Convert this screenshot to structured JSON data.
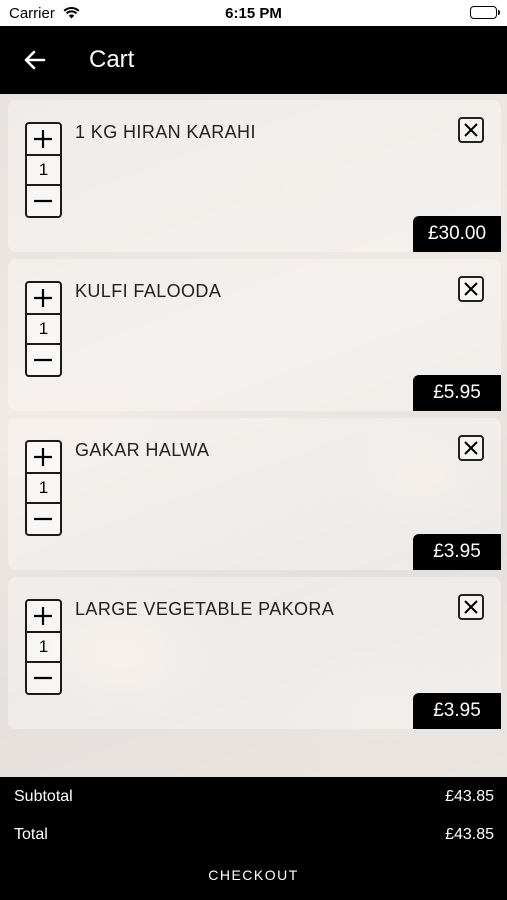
{
  "status_bar": {
    "carrier": "Carrier",
    "time": "6:15 PM"
  },
  "nav": {
    "title": "Cart",
    "back_icon": "arrow-left-icon"
  },
  "items": [
    {
      "name": "1 KG HIRAN KARAHI",
      "qty": "1",
      "price": "£30.00"
    },
    {
      "name": "KULFI FALOODA",
      "qty": "1",
      "price": "£5.95"
    },
    {
      "name": "GAKAR HALWA",
      "qty": "1",
      "price": "£3.95"
    },
    {
      "name": "LARGE VEGETABLE PAKORA",
      "qty": "1",
      "price": "£3.95"
    }
  ],
  "summary": {
    "subtotal_label": "Subtotal",
    "subtotal_value": "£43.85",
    "total_label": "Total",
    "total_value": "£43.85",
    "checkout_label": "CHECKOUT"
  }
}
